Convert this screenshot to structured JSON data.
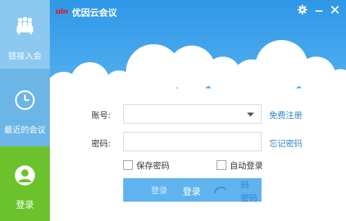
{
  "window": {
    "brand_logo": "uin",
    "title": "优因云会议"
  },
  "sidebar": {
    "items": [
      {
        "label": "链接入会",
        "icon": "meeting-people-icon"
      },
      {
        "label": "最近的会议",
        "icon": "clock-icon"
      },
      {
        "label": "登录",
        "icon": "user-avatar-icon"
      }
    ]
  },
  "form": {
    "account_label": "账号:",
    "password_label": "密码:",
    "account_value": "",
    "password_value": "",
    "register_link": "免费注册",
    "forgot_link": "忘记密码",
    "save_password_label": "保存密码",
    "auto_login_label": "自动登录",
    "login_button": "登录",
    "ghost_login_text": "登录",
    "ghost_pw_a": "码",
    "ghost_pw_b": "密码"
  },
  "colors": {
    "sky_top": "#2f97e8",
    "sidebar": "#5fb0e6",
    "login_green": "#6cc22d",
    "link_blue": "#2f84c8",
    "button_blue": "#5fb4ee",
    "brand_red": "#e01818"
  }
}
